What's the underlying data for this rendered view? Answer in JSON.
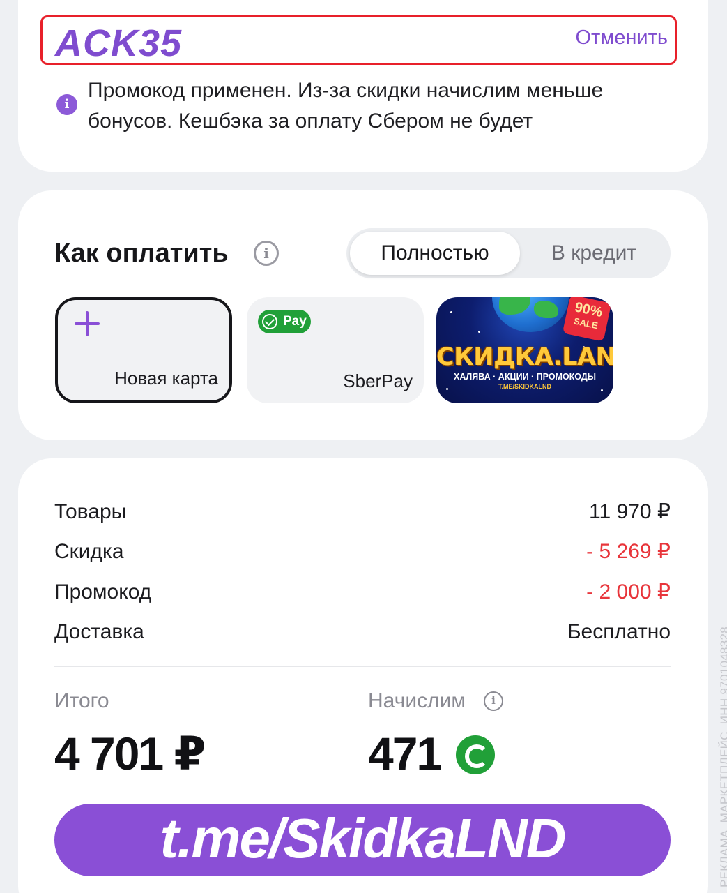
{
  "promo": {
    "code": "ACK35",
    "cancel_label": "Отменить",
    "info_icon": "info-icon",
    "note": "Промокод применен. Из-за скидки начислим меньше бонусов. Кешбэка за оплату Сбером не будет"
  },
  "payment": {
    "title": "Как оплатить",
    "help_icon": "info-icon",
    "toggle": {
      "full_label": "Полностью",
      "credit_label": "В кредит",
      "selected": "Полностью"
    },
    "methods": {
      "new_card_label": "Новая карта",
      "new_card_icon": "plus-icon",
      "sberpay_badge": "Pay",
      "sberpay_label": "SberPay"
    },
    "ad": {
      "title": "СКИДКА.LAND",
      "subtitle": "ХАЛЯВА · АКЦИИ · ПРОМОКОДЫ",
      "link": "T.ME/SKIDKALND",
      "tag_percent": "90%",
      "tag_sale": "SALE"
    }
  },
  "summary": {
    "rows": [
      {
        "label": "Товары",
        "value": "11 970 ₽"
      },
      {
        "label": "Скидка",
        "value": "- 5 269 ₽"
      },
      {
        "label": "Промокод",
        "value": "- 2 000 ₽"
      },
      {
        "label": "Доставка",
        "value": "Бесплатно"
      }
    ],
    "total_label": "Итого",
    "total_value": "4 701 ₽",
    "bonus_label": "Начислим",
    "bonus_value": "471",
    "bonus_icon": "sber-bonus-icon"
  },
  "cta": {
    "label": "t.me/SkidkaLND"
  },
  "disclaimer": "РЕКЛАМА. МАРКЕТПЛЕЙС, ИНН 9701048328",
  "colors": {
    "accent": "#8a4fd6",
    "promo_text": "#7f4ccf",
    "discount_red": "#e8353b",
    "highlight_border": "#e8202a",
    "sber_green": "#21a038"
  }
}
